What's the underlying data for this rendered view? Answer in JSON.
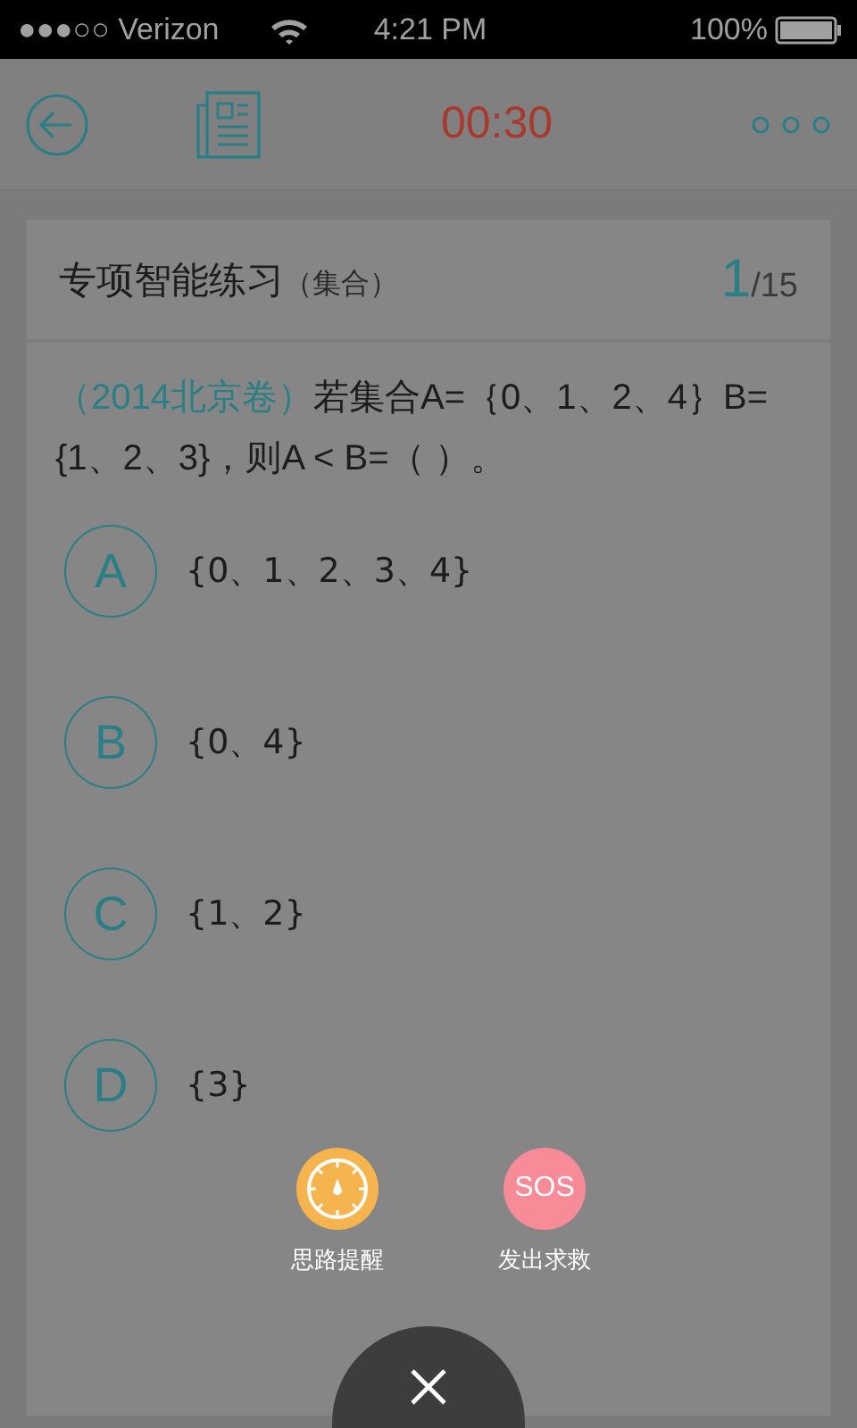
{
  "status_bar": {
    "carrier": "●●●○○ Verizon",
    "time": "4:21 PM",
    "battery": "100%"
  },
  "header": {
    "timer": "00:30"
  },
  "card": {
    "title": "专项智能练习",
    "subtitle": "（集合）",
    "current": "1",
    "total": "/15"
  },
  "question": {
    "source": "（2014北京卷）",
    "text": "若集合A=｛0、1、2、4｝B={1、2、3}，则A < B=（ ）。"
  },
  "options": [
    {
      "letter": "A",
      "text": "{0、1、2、3、4}"
    },
    {
      "letter": "B",
      "text": "{0、4}"
    },
    {
      "letter": "C",
      "text": "{1、2}"
    },
    {
      "letter": "D",
      "text": "{3}"
    }
  ],
  "popup": {
    "actions": [
      {
        "kind": "hint",
        "label": "思路提醒"
      },
      {
        "kind": "sos",
        "icon_text": "SOS",
        "label": "发出求救"
      }
    ]
  }
}
